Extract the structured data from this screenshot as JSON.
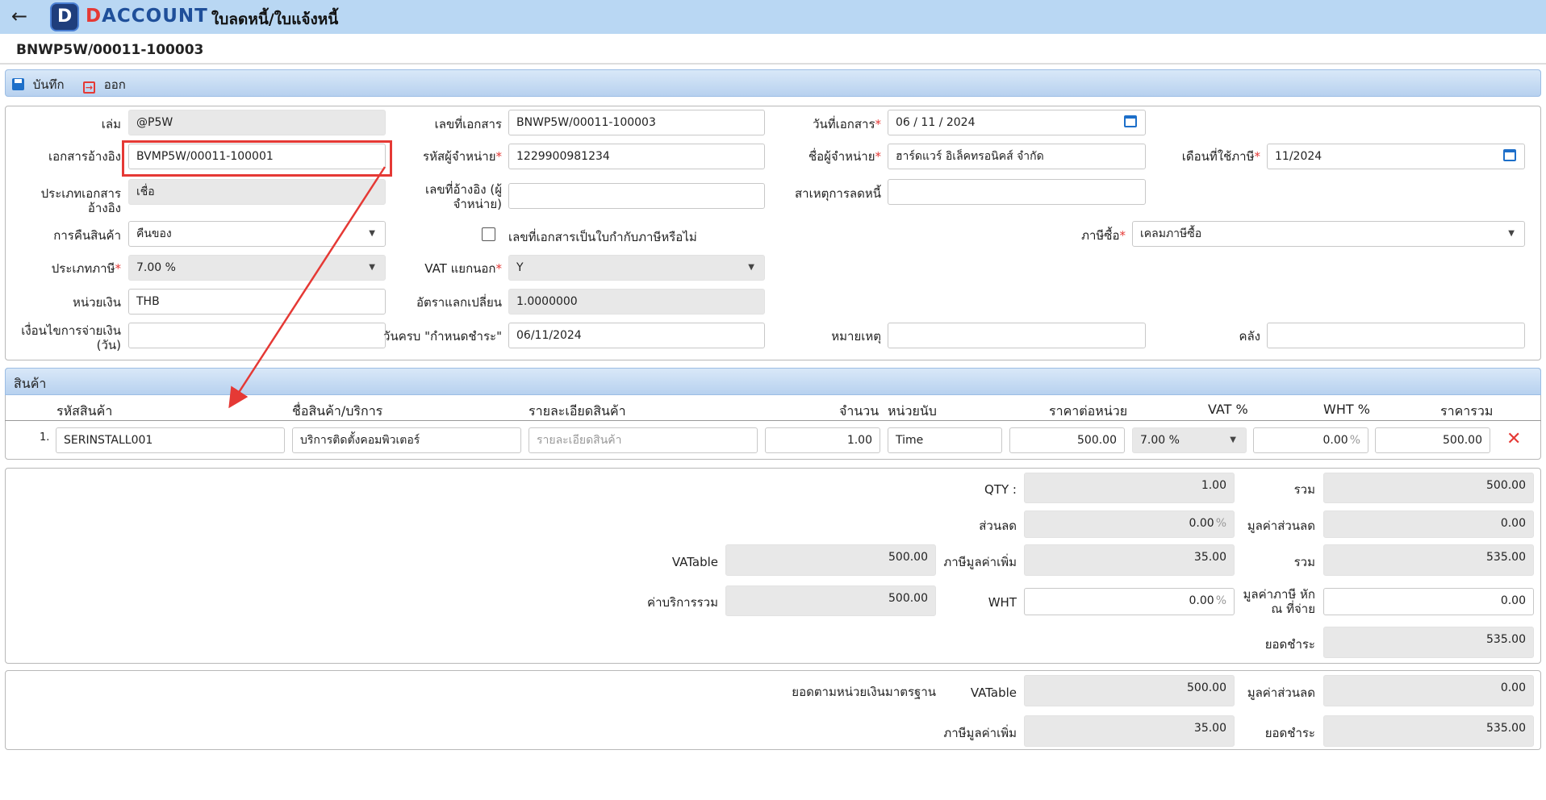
{
  "header": {
    "back_icon": "arrow-left-icon",
    "brand": "DACCOUNT",
    "brand_first": "D",
    "brand_rest": "ACCOUNT",
    "title": "ใบลดหนี้/ใบแจ้งหนี้"
  },
  "doc_number": "BNWP5W/00011-100003",
  "toolbar": {
    "save": "บันทึก",
    "exit": "ออก"
  },
  "form": {
    "book": {
      "label": "เล่ม",
      "value": "@P5W"
    },
    "ref_doc": {
      "label": "เอกสารอ้างอิง",
      "value": "BVMP5W/00011-100001"
    },
    "ref_doc_type": {
      "label": "ประเภทเอกสารอ้างอิง",
      "value": "เชื่อ"
    },
    "return_goods": {
      "label": "การคืนสินค้า",
      "value": "คืนของ"
    },
    "tax_type": {
      "label": "ประเภทภาษี",
      "value": "7.00 %"
    },
    "currency": {
      "label": "หน่วยเงิน",
      "value": "THB"
    },
    "payment_terms": {
      "label1": "เงื่อนไขการจ่ายเงิน",
      "label2": "(วัน)",
      "value": ""
    },
    "doc_no": {
      "label": "เลขที่เอกสาร",
      "value": "BNWP5W/00011-100003"
    },
    "vendor_code": {
      "label": "รหัสผู้จำหน่าย",
      "value": "1229900981234"
    },
    "vendor_ref": {
      "label1": "เลขที่อ้างอิง (ผู้",
      "label2": "จำหน่าย)",
      "value": ""
    },
    "is_tax_invoice": {
      "label": "เลขที่เอกสารเป็นใบกำกับภาษีหรือไม่",
      "checked": false
    },
    "vat_separate": {
      "label": "VAT แยกนอก",
      "value": "Y"
    },
    "exchange_rate": {
      "label": "อัตราแลกเปลี่ยน",
      "value": "1.0000000"
    },
    "due_date": {
      "label": "วันครบ \"กำหนดชำระ\"",
      "value": "06/11/2024"
    },
    "doc_date": {
      "label": "วันที่เอกสาร",
      "value": "06 / 11 /  2024"
    },
    "vendor_name": {
      "label": "ชื่อผู้จำหน่าย",
      "value": "ฮาร์ดแวร์ อิเล็คทรอนิคส์ จำกัด"
    },
    "reduce_reason": {
      "label": "สาเหตุการลดหนี้",
      "value": ""
    },
    "remark": {
      "label": "หมายเหตุ",
      "value": ""
    },
    "tax_month": {
      "label": "เดือนที่ใช้ภาษี",
      "value": "11/2024"
    },
    "purchase_tax": {
      "label": "ภาษีซื้อ",
      "value": "เคลมภาษีซื้อ"
    },
    "warehouse": {
      "label": "คลัง",
      "value": ""
    }
  },
  "products": {
    "section_title": "สินค้า",
    "columns": [
      "รหัสสินค้า",
      "ชื่อสินค้า/บริการ",
      "รายละเอียดสินค้า",
      "จำนวน",
      "หน่วยนับ",
      "ราคาต่อหน่วย",
      "VAT %",
      "WHT %",
      "ราคารวม"
    ],
    "rows": [
      {
        "index": "1.",
        "code": "SERINSTALL001",
        "name": "บริการติดตั้งคอมพิวเตอร์",
        "detail_placeholder": "รายละเอียดสินค้า",
        "qty": "1.00",
        "unit": "Time",
        "unit_price": "500.00",
        "vat": "7.00 %",
        "wht": "0.00",
        "wht_pct": "%",
        "total": "500.00"
      }
    ]
  },
  "summary": {
    "qty": {
      "label": "QTY :",
      "value": "1.00"
    },
    "total1": {
      "label": "รวม",
      "value": "500.00"
    },
    "discount": {
      "label": "ส่วนลด",
      "value": "0.00",
      "pct": "%"
    },
    "discount_value": {
      "label": "มูลค่าส่วนลด",
      "value": "0.00"
    },
    "vatable": {
      "label": "VATable",
      "value": "500.00"
    },
    "vat_amount": {
      "label": "ภาษีมูลค่าเพิ่ม",
      "value": "35.00"
    },
    "total2": {
      "label": "รวม",
      "value": "535.00"
    },
    "service_total": {
      "label": "ค่าบริการรวม",
      "value": "500.00"
    },
    "wht": {
      "label": "WHT",
      "value": "0.00",
      "pct": "%"
    },
    "wht_amount": {
      "label1": "มูลค่าภาษี หัก",
      "label2": "ณ ที่จ่าย",
      "value": "0.00"
    },
    "net": {
      "label": "ยอดชำระ",
      "value": "535.00"
    }
  },
  "base_currency": {
    "title": "ยอดตามหน่วยเงินมาตรฐาน",
    "vatable": {
      "label": "VATable",
      "value": "500.00"
    },
    "discount_value": {
      "label": "มูลค่าส่วนลด",
      "value": "0.00"
    },
    "vat_amount": {
      "label": "ภาษีมูลค่าเพิ่ม",
      "value": "35.00"
    },
    "net": {
      "label": "ยอดชำระ",
      "value": "535.00"
    }
  }
}
